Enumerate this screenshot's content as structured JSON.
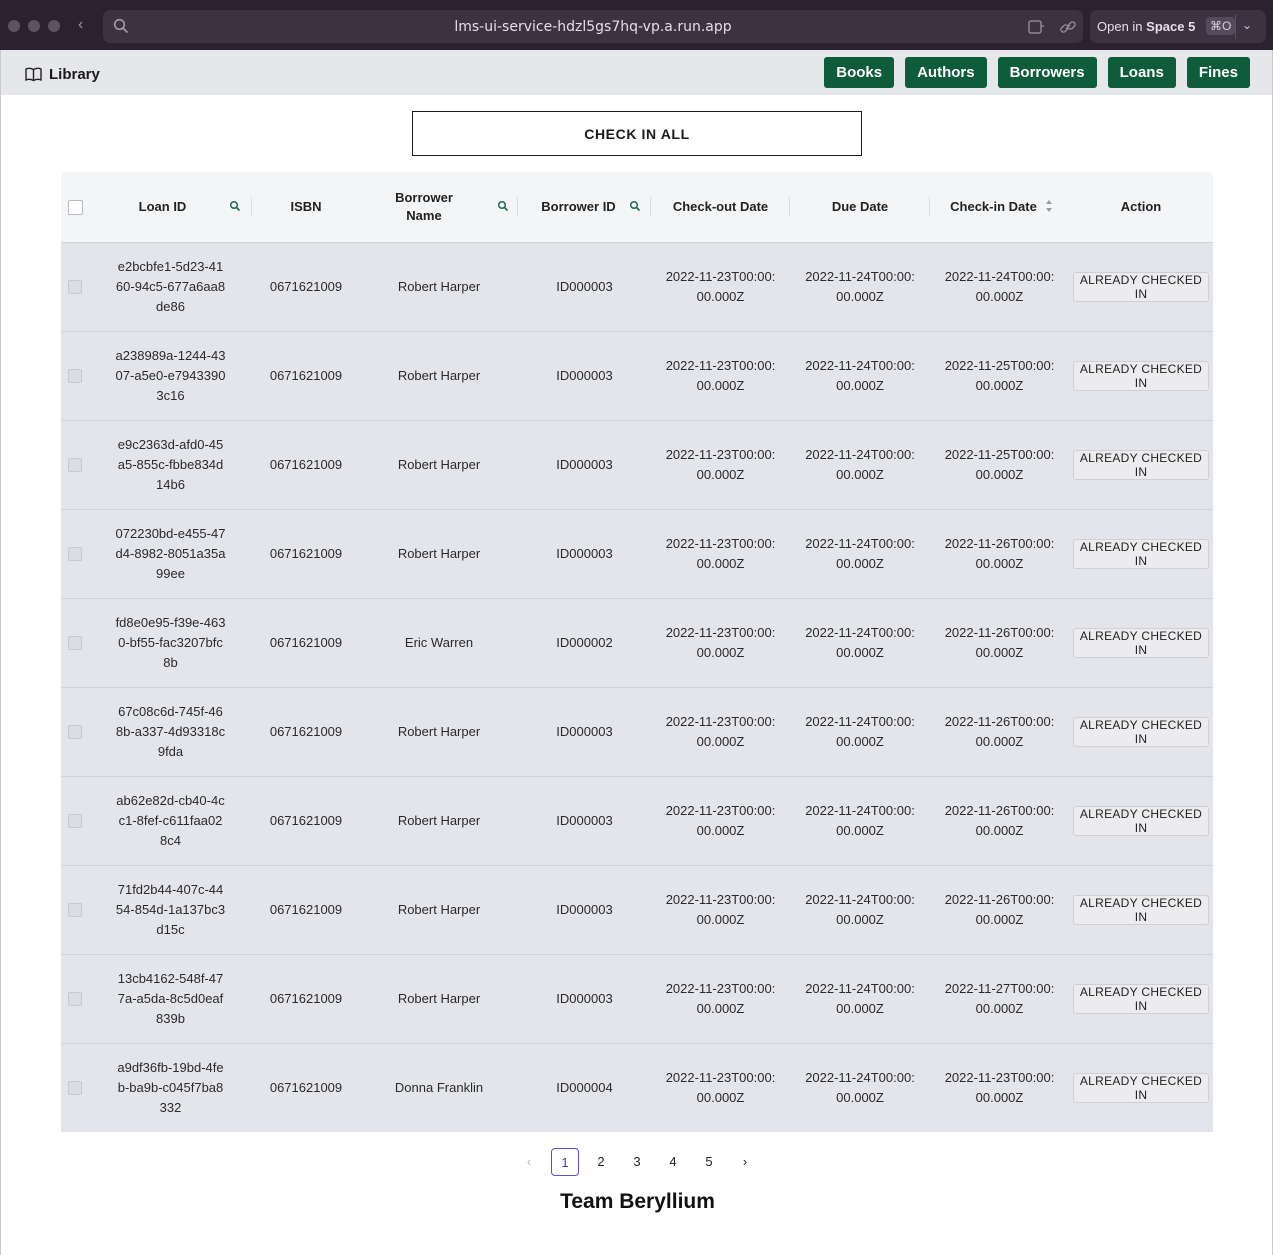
{
  "browser": {
    "url": "lms-ui-service-hdzl5gs7hq-vp.a.run.app",
    "open_in_prefix": "Open in",
    "open_in_space": "Space 5",
    "open_in_shortcut": "⌘O"
  },
  "header": {
    "brand": "Library",
    "nav": [
      "Books",
      "Authors",
      "Borrowers",
      "Loans",
      "Fines"
    ]
  },
  "actions": {
    "check_in_all": "CHECK IN ALL"
  },
  "table": {
    "columns": [
      "Loan ID",
      "ISBN",
      "Borrower Name",
      "Borrower ID",
      "Check-out Date",
      "Due Date",
      "Check-in Date",
      "Action"
    ],
    "rows": [
      {
        "loan_id": "e2bcbfe1-5d23-4160-94c5-677a6aa8de86",
        "isbn": "0671621009",
        "borrower_name": "Robert Harper",
        "borrower_id": "ID000003",
        "checkout": "2022-11-23T00:00:00.000Z",
        "due": "2022-11-24T00:00:00.000Z",
        "checkin": "2022-11-24T00:00:00.000Z",
        "action": "ALREADY CHECKED IN"
      },
      {
        "loan_id": "a238989a-1244-4307-a5e0-e79433903c16",
        "isbn": "0671621009",
        "borrower_name": "Robert Harper",
        "borrower_id": "ID000003",
        "checkout": "2022-11-23T00:00:00.000Z",
        "due": "2022-11-24T00:00:00.000Z",
        "checkin": "2022-11-25T00:00:00.000Z",
        "action": "ALREADY CHECKED IN"
      },
      {
        "loan_id": "e9c2363d-afd0-45a5-855c-fbbe834d14b6",
        "isbn": "0671621009",
        "borrower_name": "Robert Harper",
        "borrower_id": "ID000003",
        "checkout": "2022-11-23T00:00:00.000Z",
        "due": "2022-11-24T00:00:00.000Z",
        "checkin": "2022-11-25T00:00:00.000Z",
        "action": "ALREADY CHECKED IN"
      },
      {
        "loan_id": "072230bd-e455-47d4-8982-8051a35a99ee",
        "isbn": "0671621009",
        "borrower_name": "Robert Harper",
        "borrower_id": "ID000003",
        "checkout": "2022-11-23T00:00:00.000Z",
        "due": "2022-11-24T00:00:00.000Z",
        "checkin": "2022-11-26T00:00:00.000Z",
        "action": "ALREADY CHECKED IN"
      },
      {
        "loan_id": "fd8e0e95-f39e-4630-bf55-fac3207bfc8b",
        "isbn": "0671621009",
        "borrower_name": "Eric Warren",
        "borrower_id": "ID000002",
        "checkout": "2022-11-23T00:00:00.000Z",
        "due": "2022-11-24T00:00:00.000Z",
        "checkin": "2022-11-26T00:00:00.000Z",
        "action": "ALREADY CHECKED IN"
      },
      {
        "loan_id": "67c08c6d-745f-468b-a337-4d93318c9fda",
        "isbn": "0671621009",
        "borrower_name": "Robert Harper",
        "borrower_id": "ID000003",
        "checkout": "2022-11-23T00:00:00.000Z",
        "due": "2022-11-24T00:00:00.000Z",
        "checkin": "2022-11-26T00:00:00.000Z",
        "action": "ALREADY CHECKED IN"
      },
      {
        "loan_id": "ab62e82d-cb40-4cc1-8fef-c611faa028c4",
        "isbn": "0671621009",
        "borrower_name": "Robert Harper",
        "borrower_id": "ID000003",
        "checkout": "2022-11-23T00:00:00.000Z",
        "due": "2022-11-24T00:00:00.000Z",
        "checkin": "2022-11-26T00:00:00.000Z",
        "action": "ALREADY CHECKED IN"
      },
      {
        "loan_id": "71fd2b44-407c-4454-854d-1a137bc3d15c",
        "isbn": "0671621009",
        "borrower_name": "Robert Harper",
        "borrower_id": "ID000003",
        "checkout": "2022-11-23T00:00:00.000Z",
        "due": "2022-11-24T00:00:00.000Z",
        "checkin": "2022-11-26T00:00:00.000Z",
        "action": "ALREADY CHECKED IN"
      },
      {
        "loan_id": "13cb4162-548f-477a-a5da-8c5d0eaf839b",
        "isbn": "0671621009",
        "borrower_name": "Robert Harper",
        "borrower_id": "ID000003",
        "checkout": "2022-11-23T00:00:00.000Z",
        "due": "2022-11-24T00:00:00.000Z",
        "checkin": "2022-11-27T00:00:00.000Z",
        "action": "ALREADY CHECKED IN"
      },
      {
        "loan_id": "a9df36fb-19bd-4feb-ba9b-c045f7ba8332",
        "isbn": "0671621009",
        "borrower_name": "Donna Franklin",
        "borrower_id": "ID000004",
        "checkout": "2022-11-23T00:00:00.000Z",
        "due": "2022-11-24T00:00:00.000Z",
        "checkin": "2022-11-23T00:00:00.000Z",
        "action": "ALREADY CHECKED IN"
      }
    ]
  },
  "pagination": {
    "pages": [
      "1",
      "2",
      "3",
      "4",
      "5"
    ],
    "current": "1"
  },
  "footer": {
    "team": "Team Beryllium"
  },
  "colors": {
    "accent": "#0e5c3a",
    "pager_active": "#5b4ec9"
  }
}
